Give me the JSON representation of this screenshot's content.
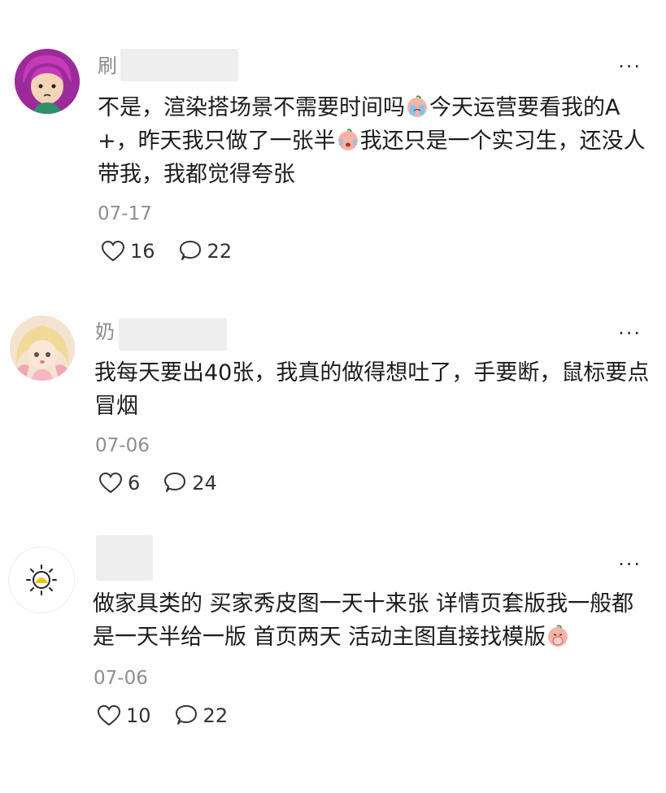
{
  "comments": [
    {
      "name": "刷",
      "text_parts": [
        "不是，渲染搭场景不需要时间吗",
        "今天运营要看我的A+，昨天我只做了一张半",
        "我还只是一个实习生，还没人带我，我都觉得夸张"
      ],
      "date": "07-17",
      "likes": "16",
      "replies": "22"
    },
    {
      "name": "奶",
      "text_parts": [
        "我每天要出40张，我真的做得想吐了，手要断，鼠标要点冒烟"
      ],
      "date": "07-06",
      "likes": "6",
      "replies": "24"
    },
    {
      "name": "",
      "text_parts": [
        "做家具类的 买家秀皮图一天十来张 详情页套版我一般都是一天半给一版 首页两天 活动主图直接找模版"
      ],
      "date": "07-06",
      "likes": "10",
      "replies": "22"
    }
  ],
  "more_label": "···",
  "icons": {
    "like": "heart-icon",
    "reply": "comment-bubble-icon",
    "more": "more-dots-icon"
  },
  "colors": {
    "name": "#8a8a8a",
    "date": "#8e8e8e",
    "text": "#1c1c1c",
    "avatar1": "#9c2a9a",
    "avatar3_sun": "#f0c400"
  }
}
